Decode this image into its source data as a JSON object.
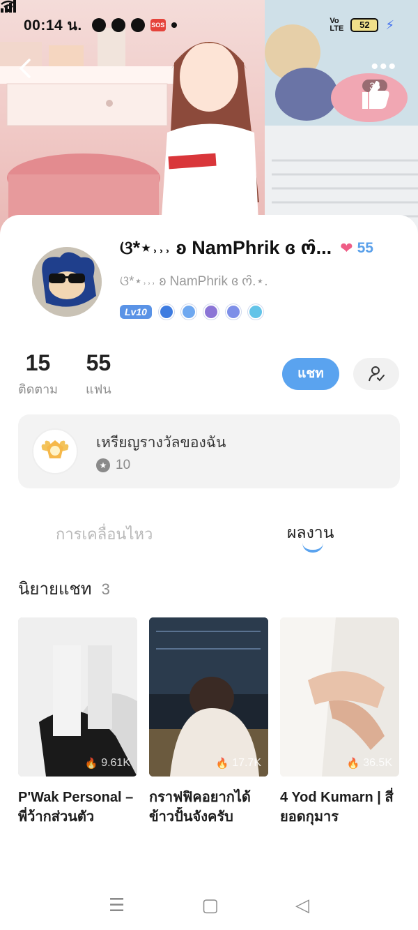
{
  "status_bar": {
    "time": "00:14 น.",
    "battery": "52",
    "icons": [
      "chat-bubble-icon",
      "messenger-icon",
      "facebook-icon",
      "sos-icon",
      "dot-icon",
      "wifi-icon",
      "volte-icon",
      "signal-icon",
      "battery-icon",
      "charging-icon"
    ]
  },
  "header": {
    "back_icon": "chevron-left-icon",
    "more_icon": "more-horizontal-icon",
    "like_count": "35"
  },
  "profile": {
    "name": "ଓ*⋆˒˒˒ ʚ NamPhrik ɞ ო̑̑...",
    "subname": "ଓ*⋆˒˒˒ ʚ NamPhrik ɞ ო̑̑.⋆.",
    "fans_count": "55",
    "level": "Lv10",
    "badge_colors": [
      "#3d7be0",
      "#6fa8f0",
      "#8b75d6",
      "#7d8fe8",
      "#62c3e8"
    ]
  },
  "stats": {
    "following_num": "15",
    "following_label": "ติดตาม",
    "fans_num": "55",
    "fans_label": "แฟน"
  },
  "actions": {
    "chat_label": "แชท"
  },
  "medals": {
    "title": "เหรียญรางวัลของฉัน",
    "count": "10"
  },
  "tabs": {
    "activity": "การเคลื่อนไหว",
    "works": "ผลงาน"
  },
  "section": {
    "title": "นิยายแชท",
    "count": "3"
  },
  "works": [
    {
      "title_line1": "P'Wak Personal –",
      "title_line2": "พี่ว้ากส่วนตัว",
      "views": "9.61K"
    },
    {
      "title_line1": "กราฟฟิคอยากได้",
      "title_line2": "ข้าวปั้นจังครับ",
      "views": "17.7K"
    },
    {
      "title_line1": "4 Yod Kumarn | สี่",
      "title_line2": "ยอดกุมาร",
      "views": "36.5K"
    }
  ],
  "accent_color": "#5aa3ef"
}
